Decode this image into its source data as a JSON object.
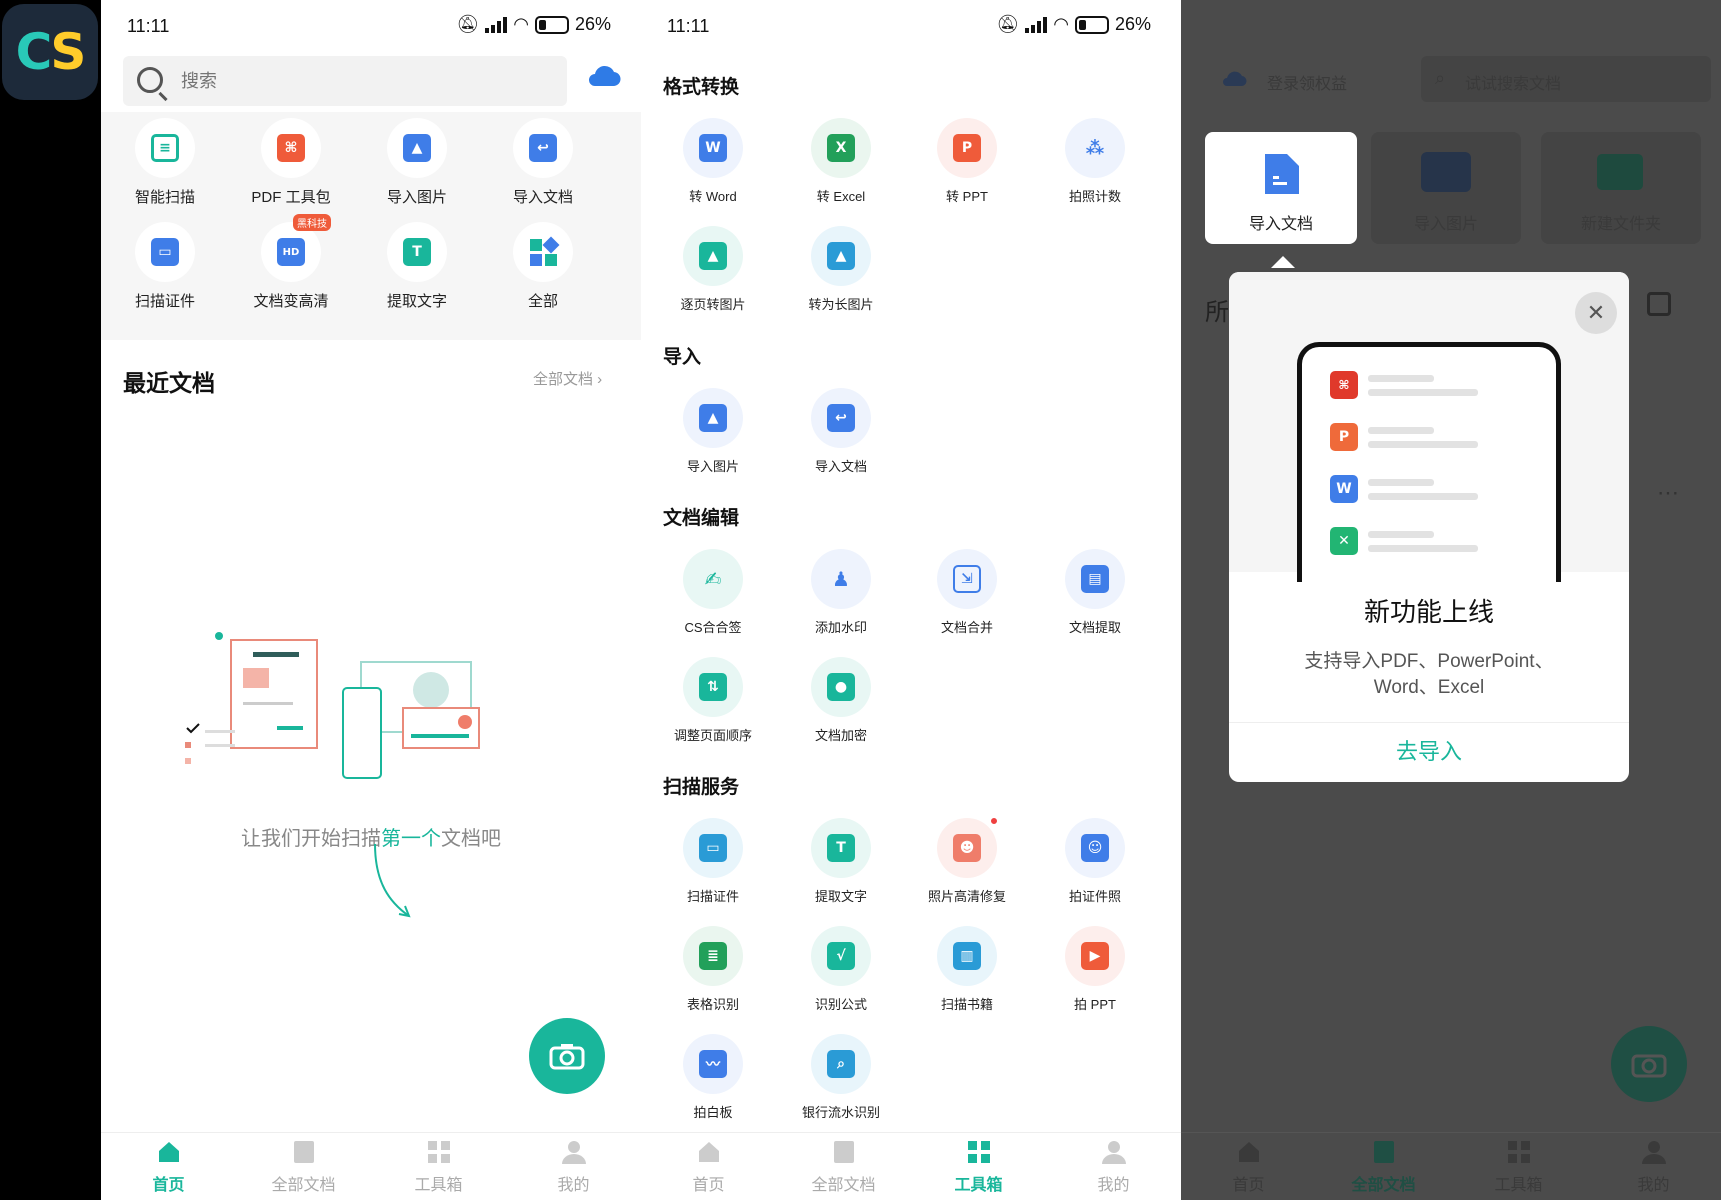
{
  "app": {
    "logo_text_c": "C",
    "logo_text_s": "S"
  },
  "colors": {
    "accent": "#19b69b",
    "dim_bg": "#4b4b4b",
    "badge": "#ef5b3a"
  },
  "screen1": {
    "status": {
      "time": "11:11",
      "battery": "26%"
    },
    "search": {
      "placeholder": "搜索"
    },
    "tools": [
      {
        "label": "智能扫描",
        "icon": "scan-icon"
      },
      {
        "label": "PDF 工具包",
        "icon": "pdf-icon"
      },
      {
        "label": "导入图片",
        "icon": "import-image-icon"
      },
      {
        "label": "导入文档",
        "icon": "import-doc-icon"
      },
      {
        "label": "扫描证件",
        "icon": "id-card-icon"
      },
      {
        "label": "文档变高清",
        "icon": "hd-icon",
        "badge": "黑科技"
      },
      {
        "label": "提取文字",
        "icon": "text-icon"
      },
      {
        "label": "全部",
        "icon": "all-icon"
      }
    ],
    "recent": {
      "title": "最近文档",
      "see_all": "全部文档 ›"
    },
    "empty": {
      "pre": "让我们开始扫描",
      "highlight": "第一个",
      "post": "文档吧"
    },
    "tabs": [
      "首页",
      "全部文档",
      "工具箱",
      "我的"
    ]
  },
  "screen2": {
    "status": {
      "time": "11:11",
      "battery": "26%"
    },
    "sections": [
      {
        "title": "格式转换",
        "items": [
          "转 Word",
          "转 Excel",
          "转 PPT",
          "拍照计数",
          "逐页转图片",
          "转为长图片"
        ]
      },
      {
        "title": "导入",
        "items": [
          "导入图片",
          "导入文档"
        ]
      },
      {
        "title": "文档编辑",
        "items": [
          "CS合合签",
          "添加水印",
          "文档合并",
          "文档提取",
          "调整页面顺序",
          "文档加密"
        ]
      },
      {
        "title": "扫描服务",
        "items": [
          "扫描证件",
          "提取文字",
          "照片高清修复",
          "拍证件照",
          "表格识别",
          "识别公式",
          "扫描书籍",
          "拍 PPT",
          "拍白板",
          "银行流水识别"
        ]
      }
    ],
    "tabs": [
      "首页",
      "全部文档",
      "工具箱",
      "我的"
    ]
  },
  "screen3": {
    "header": {
      "login": "登录领权益",
      "search_placeholder": "试试搜索文档"
    },
    "actions": [
      "导入文档",
      "导入图片",
      "新建文件夹"
    ],
    "section_initial": "所",
    "dialog": {
      "title": "新功能上线",
      "desc_line1": "支持导入PDF、PowerPoint、",
      "desc_line2": "Word、Excel",
      "button": "去导入"
    },
    "tabs": [
      "首页",
      "全部文档",
      "工具箱",
      "我的"
    ]
  }
}
